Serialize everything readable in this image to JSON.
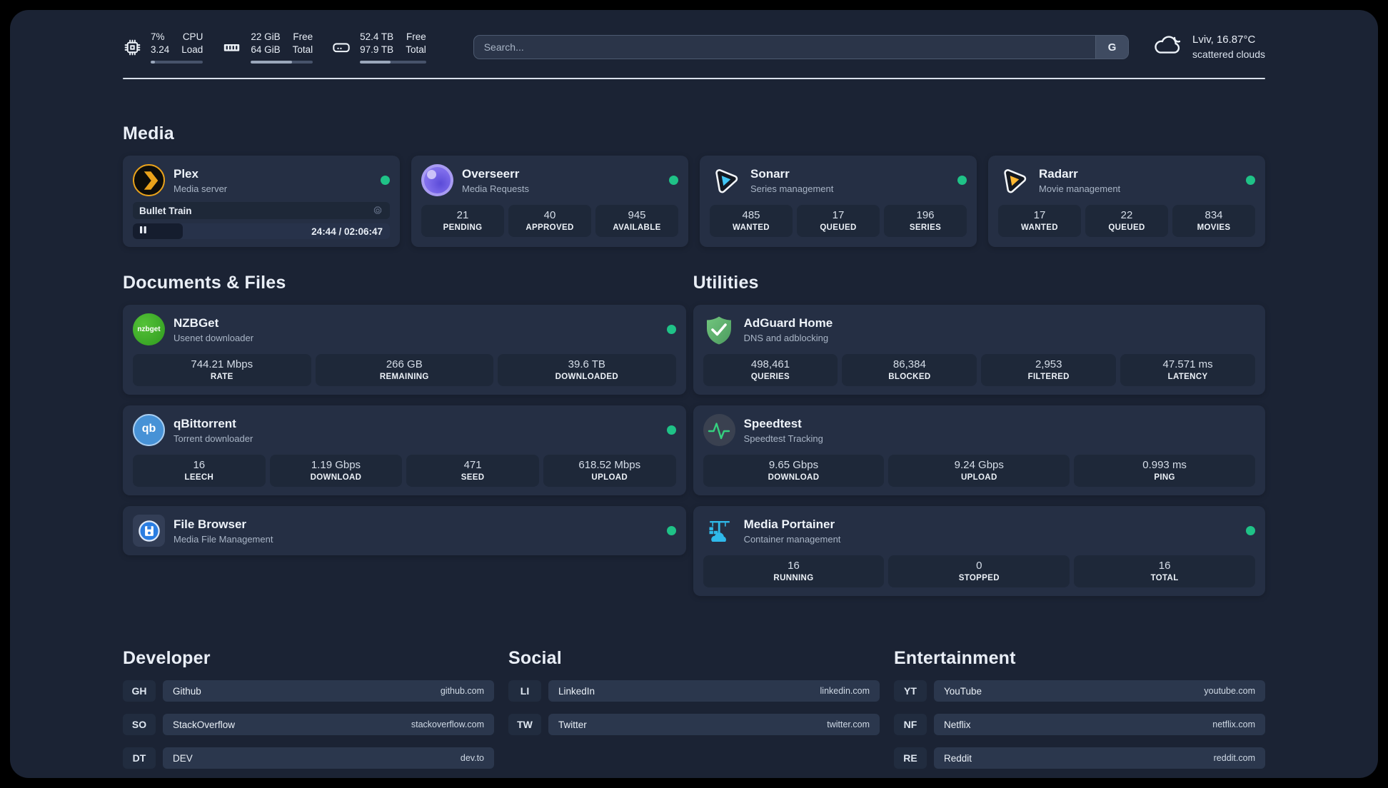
{
  "header": {
    "system_stats": [
      {
        "icon": "cpu-icon",
        "values": [
          "7%",
          "3.24"
        ],
        "labels": [
          "CPU",
          "Load"
        ],
        "progress_width": "8%"
      },
      {
        "icon": "ram-icon",
        "values": [
          "22 GiB",
          "64 GiB"
        ],
        "labels": [
          "Free",
          "Total"
        ],
        "progress_width": "66%"
      },
      {
        "icon": "disk-icon",
        "values": [
          "52.4 TB",
          "97.9 TB"
        ],
        "labels": [
          "Free",
          "Total"
        ],
        "progress_width": "46%"
      }
    ],
    "search": {
      "placeholder": "Search...",
      "button_label": "G"
    },
    "weather": {
      "location": "Lviv, 16.87°C",
      "condition": "scattered clouds"
    }
  },
  "sections": {
    "media": {
      "title": "Media",
      "plex": {
        "name": "Plex",
        "description": "Media server",
        "online": true,
        "now_playing": {
          "title": "Bullet Train",
          "time": "24:44 / 02:06:47",
          "progress_width": "19.5%"
        }
      },
      "overseerr": {
        "name": "Overseerr",
        "description": "Media Requests",
        "online": true,
        "stats": [
          {
            "value": "21",
            "label": "PENDING"
          },
          {
            "value": "40",
            "label": "APPROVED"
          },
          {
            "value": "945",
            "label": "AVAILABLE"
          }
        ]
      },
      "sonarr": {
        "name": "Sonarr",
        "description": "Series management",
        "online": true,
        "stats": [
          {
            "value": "485",
            "label": "WANTED"
          },
          {
            "value": "17",
            "label": "QUEUED"
          },
          {
            "value": "196",
            "label": "SERIES"
          }
        ]
      },
      "radarr": {
        "name": "Radarr",
        "description": "Movie management",
        "online": true,
        "stats": [
          {
            "value": "17",
            "label": "WANTED"
          },
          {
            "value": "22",
            "label": "QUEUED"
          },
          {
            "value": "834",
            "label": "MOVIES"
          }
        ]
      }
    },
    "documents": {
      "title": "Documents & Files",
      "nzbget": {
        "name": "NZBGet",
        "description": "Usenet downloader",
        "icon_text": "nzbget",
        "online": true,
        "stats": [
          {
            "value": "744.21 Mbps",
            "label": "RATE"
          },
          {
            "value": "266 GB",
            "label": "REMAINING"
          },
          {
            "value": "39.6 TB",
            "label": "DOWNLOADED"
          }
        ]
      },
      "qbittorrent": {
        "name": "qBittorrent",
        "description": "Torrent downloader",
        "icon_text": "qb",
        "online": true,
        "stats": [
          {
            "value": "16",
            "label": "LEECH"
          },
          {
            "value": "1.19 Gbps",
            "label": "DOWNLOAD"
          },
          {
            "value": "471",
            "label": "SEED"
          },
          {
            "value": "618.52 Mbps",
            "label": "UPLOAD"
          }
        ]
      },
      "filebrowser": {
        "name": "File Browser",
        "description": "Media File Management",
        "online": true
      }
    },
    "utilities": {
      "title": "Utilities",
      "adguard": {
        "name": "AdGuard Home",
        "description": "DNS and adblocking",
        "stats": [
          {
            "value": "498,461",
            "label": "QUERIES"
          },
          {
            "value": "86,384",
            "label": "BLOCKED"
          },
          {
            "value": "2,953",
            "label": "FILTERED"
          },
          {
            "value": "47.571 ms",
            "label": "LATENCY"
          }
        ]
      },
      "speedtest": {
        "name": "Speedtest",
        "description": "Speedtest Tracking",
        "stats": [
          {
            "value": "9.65 Gbps",
            "label": "DOWNLOAD"
          },
          {
            "value": "9.24 Gbps",
            "label": "UPLOAD"
          },
          {
            "value": "0.993 ms",
            "label": "PING"
          }
        ]
      },
      "portainer": {
        "name": "Media Portainer",
        "description": "Container management",
        "online": true,
        "stats": [
          {
            "value": "16",
            "label": "RUNNING"
          },
          {
            "value": "0",
            "label": "STOPPED"
          },
          {
            "value": "16",
            "label": "TOTAL"
          }
        ]
      }
    },
    "developer": {
      "title": "Developer",
      "links": [
        {
          "abbr": "GH",
          "name": "Github",
          "url": "github.com"
        },
        {
          "abbr": "SO",
          "name": "StackOverflow",
          "url": "stackoverflow.com"
        },
        {
          "abbr": "DT",
          "name": "DEV",
          "url": "dev.to"
        }
      ]
    },
    "social": {
      "title": "Social",
      "links": [
        {
          "abbr": "LI",
          "name": "LinkedIn",
          "url": "linkedin.com"
        },
        {
          "abbr": "TW",
          "name": "Twitter",
          "url": "twitter.com"
        }
      ]
    },
    "entertainment": {
      "title": "Entertainment",
      "links": [
        {
          "abbr": "YT",
          "name": "YouTube",
          "url": "youtube.com"
        },
        {
          "abbr": "NF",
          "name": "Netflix",
          "url": "netflix.com"
        },
        {
          "abbr": "RE",
          "name": "Reddit",
          "url": "reddit.com"
        }
      ]
    }
  },
  "colors": {
    "status_online": "#1fc287",
    "accent_plex": "#e9a21b",
    "accent_sonarr": "#41c6f3",
    "accent_radarr": "#fdb730",
    "accent_nzbget": "#3eb127",
    "accent_qbittorrent": "#4792d6",
    "accent_adguard": "#67b279",
    "accent_portainer": "#2fb9ea",
    "accent_speedtest": "#35d07f",
    "accent_filebrowser": "#2a7de1"
  }
}
